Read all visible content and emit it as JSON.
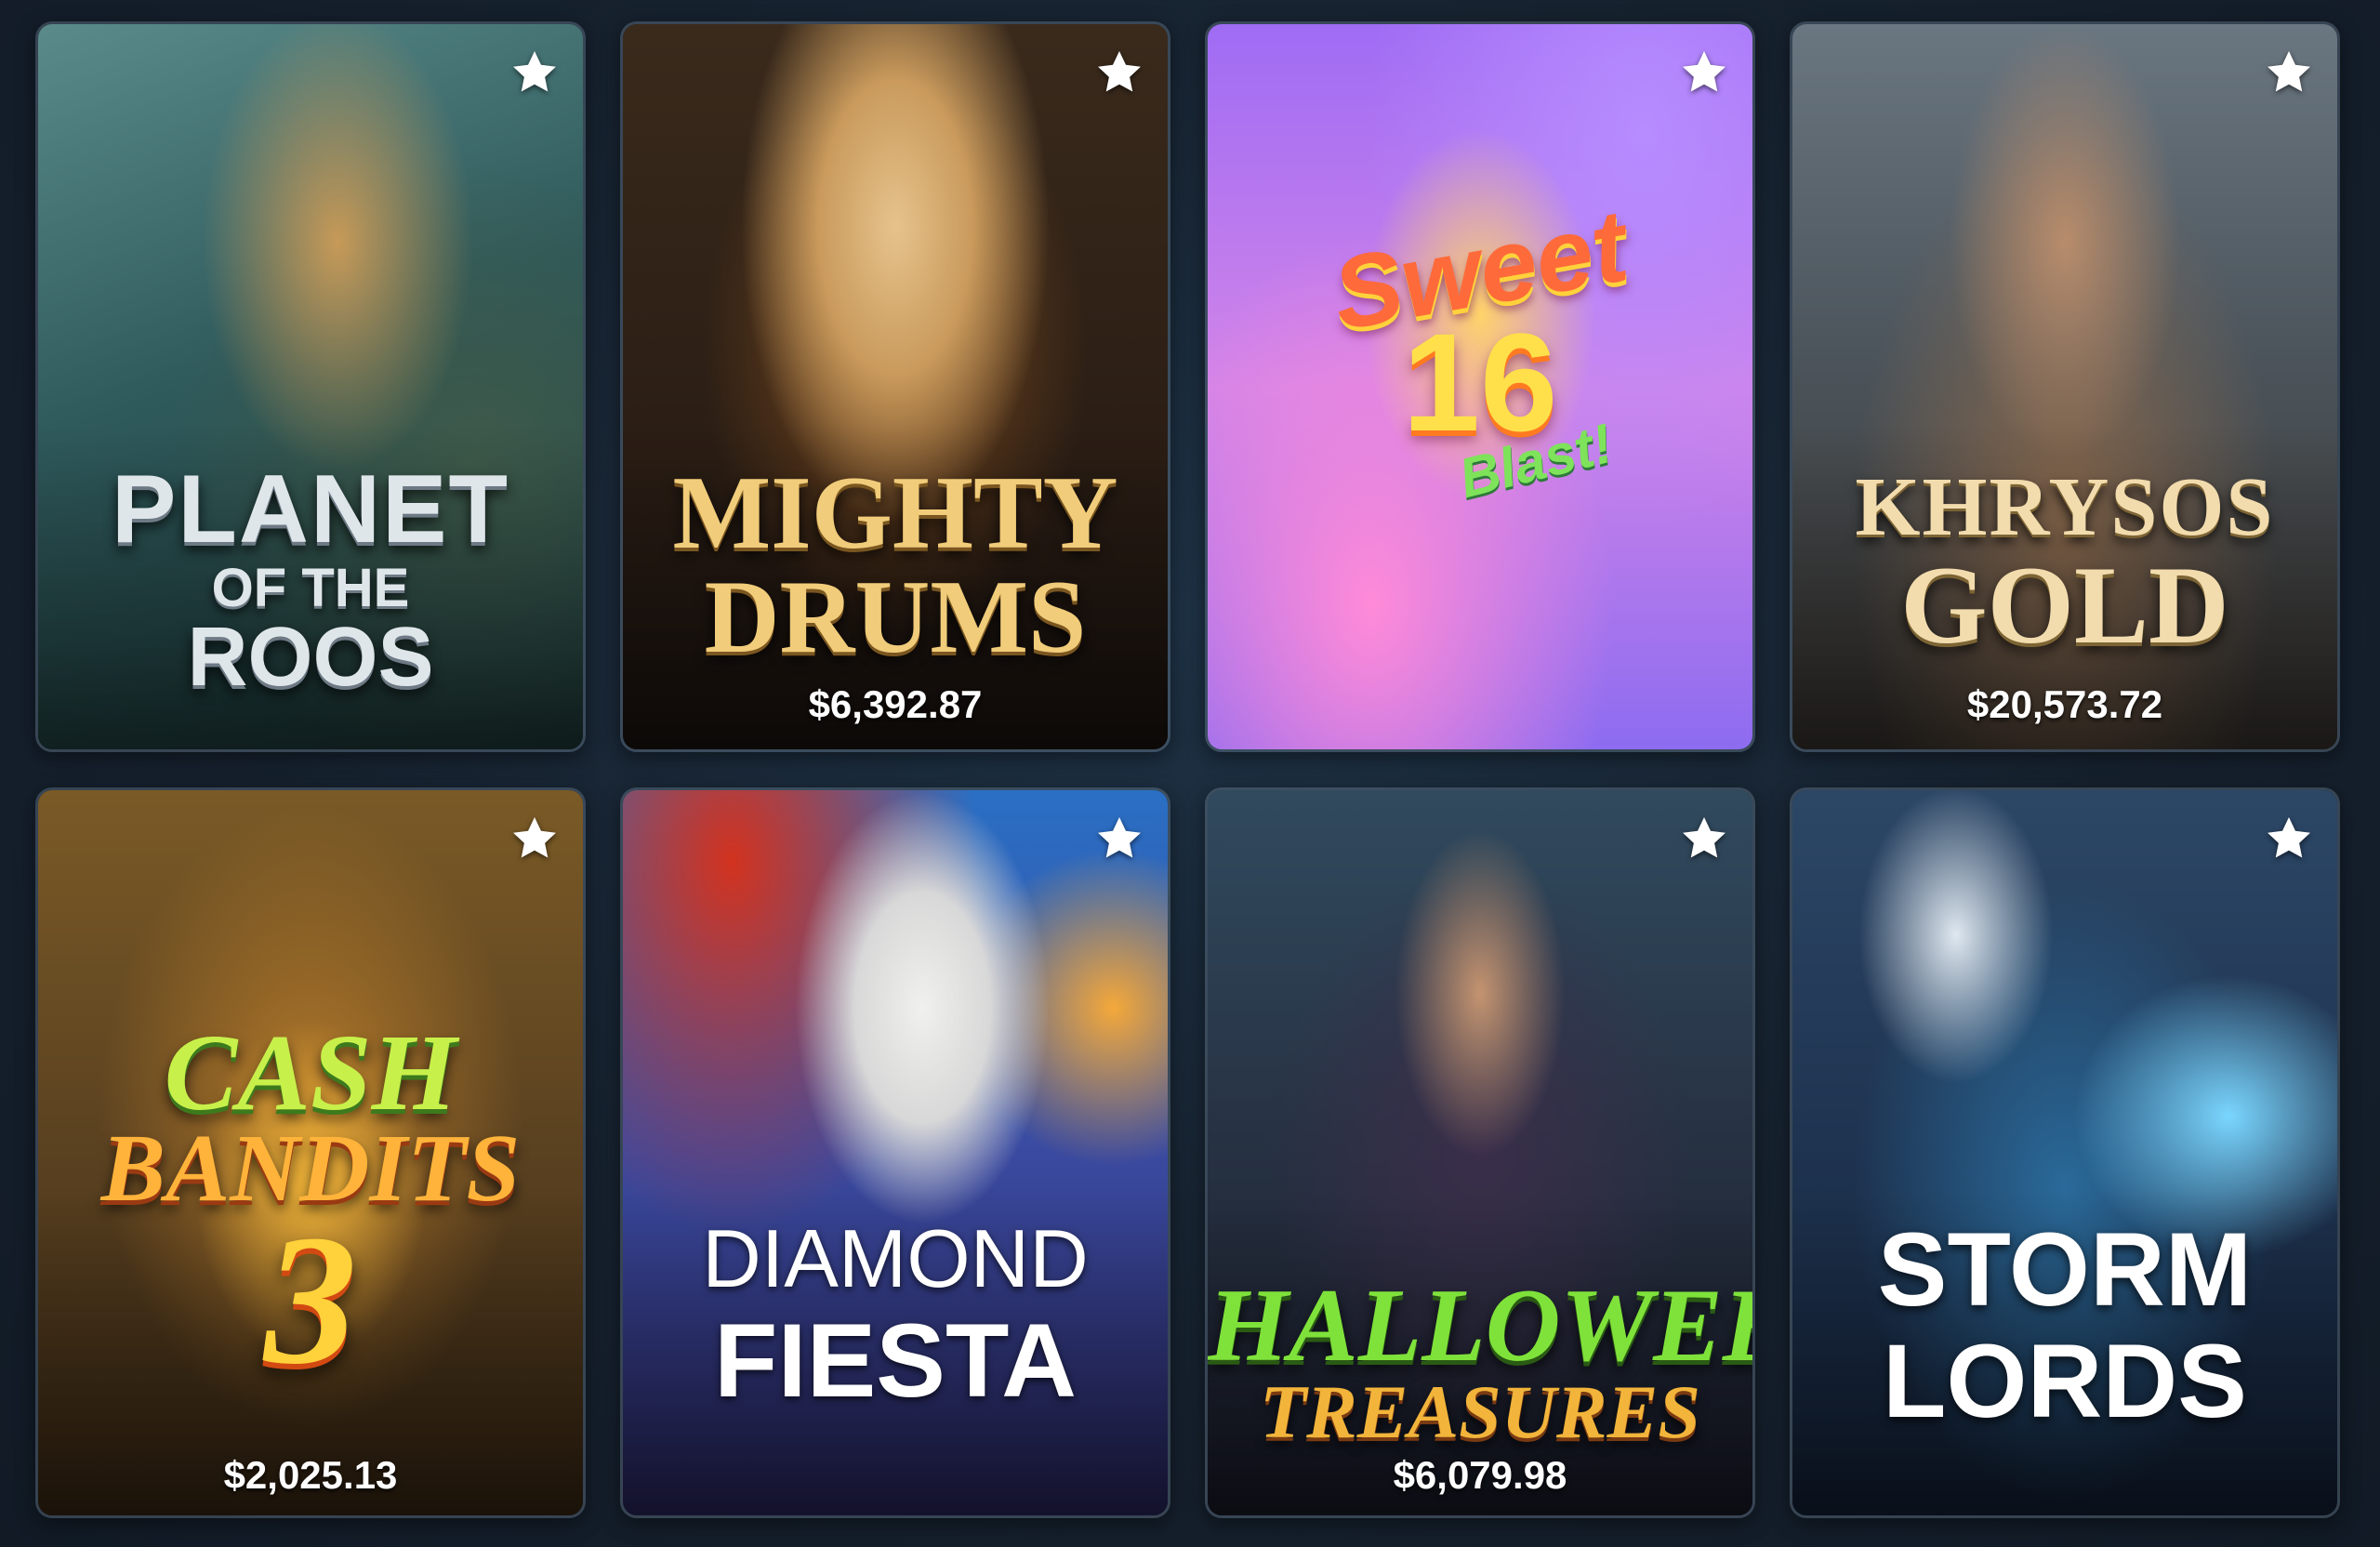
{
  "games": [
    {
      "title_line1": "PLANET",
      "title_line2": "OF THE",
      "title_line3": "ROOS",
      "jackpot": "",
      "favorite_icon": "star-icon"
    },
    {
      "title_line1": "MIGHTY",
      "title_line2": "DRUMS",
      "title_line3": "",
      "jackpot": "$6,392.87",
      "favorite_icon": "star-icon"
    },
    {
      "title_line1": "Sweet",
      "title_line2": "16",
      "title_line3": "Blast!",
      "jackpot": "",
      "favorite_icon": "star-icon"
    },
    {
      "title_line1": "KHRYSOS",
      "title_line2": "GOLD",
      "title_line3": "",
      "jackpot": "$20,573.72",
      "favorite_icon": "star-icon"
    },
    {
      "title_line1": "CASH",
      "title_line2": "BANDITS",
      "title_line3": "3",
      "jackpot": "$2,025.13",
      "favorite_icon": "star-icon"
    },
    {
      "title_line1": "DIAMOND",
      "title_line2": "FIESTA",
      "title_line3": "",
      "jackpot": "",
      "favorite_icon": "star-icon"
    },
    {
      "title_line1": "HALLOWEEN",
      "title_line2": "TREASURES",
      "title_line3": "",
      "jackpot": "$6,079.98",
      "favorite_icon": "star-icon"
    },
    {
      "title_line1": "STORM",
      "title_line2": "LORDS",
      "title_line3": "",
      "jackpot": "",
      "favorite_icon": "star-icon"
    }
  ],
  "colors": {
    "page_background": "#16212e",
    "favorite_star": "#ffffff",
    "jackpot_text": "#ffffff"
  }
}
